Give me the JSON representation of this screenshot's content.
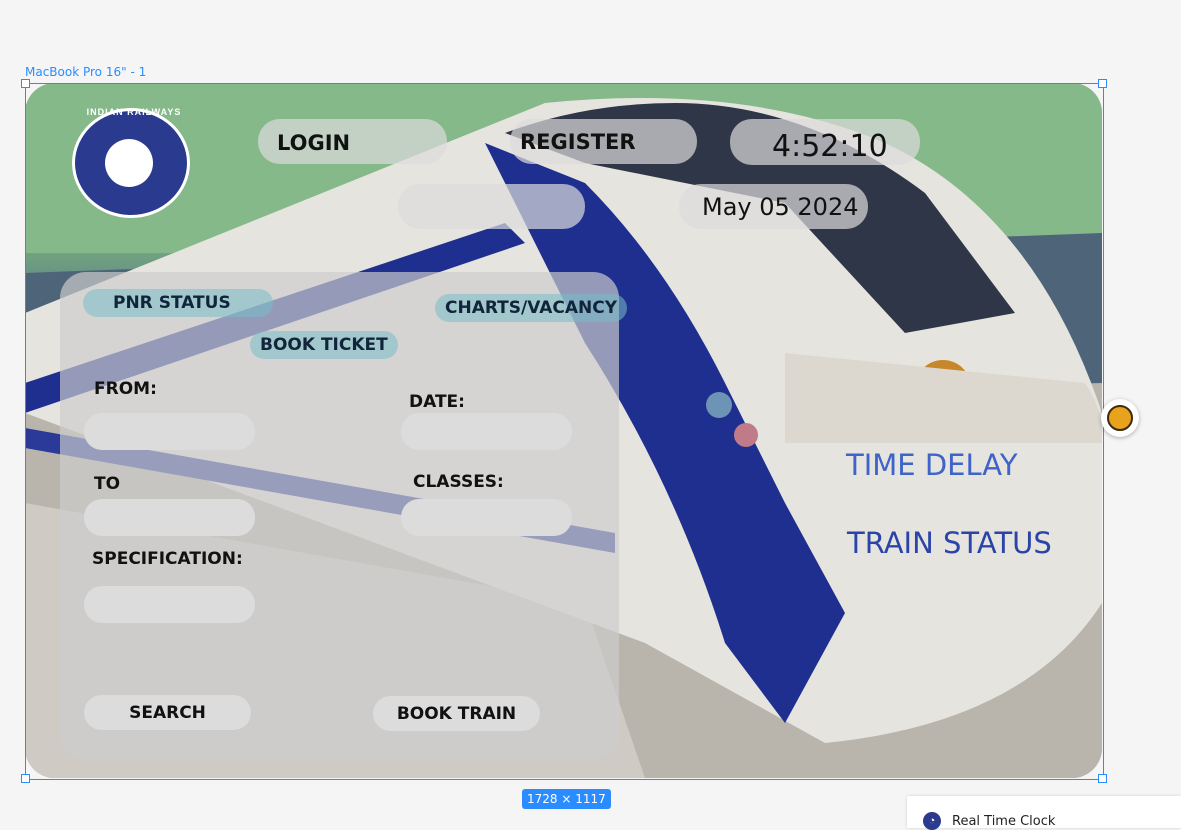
{
  "canvas": {
    "frame_label": "MacBook Pro 16\" - 1",
    "size_badge": "1728 × 1117"
  },
  "header": {
    "login_label": "LOGIN",
    "register_label": "REGISTER",
    "clock": "4:52:10",
    "date": "May 05 2024"
  },
  "logo": {
    "text": "INDIAN RAILWAYS"
  },
  "panel": {
    "tabs": {
      "pnr_status": "PNR STATUS",
      "book_ticket": "BOOK TICKET",
      "charts_vacancy": "CHARTS/VACANCY"
    },
    "labels": {
      "from": "FROM:",
      "date": "DATE:",
      "to": "TO",
      "classes": "CLASSES:",
      "specification": "SPECIFICATION:"
    },
    "buttons": {
      "search": "SEARCH",
      "book_train": "BOOK TRAIN"
    }
  },
  "side_links": {
    "time_delay": "TIME DELAY",
    "train_status": "TRAIN STATUS"
  },
  "plugin": {
    "label": "Real Time Clock"
  },
  "colors": {
    "accent": "#2a8cff",
    "link_time_delay": "#3e63c9",
    "link_train_status": "#2b44a8",
    "logo_blue": "#2a3a8e"
  },
  "icons": {
    "logo": "indian-railways-logo",
    "avatar": "user-avatar-icon",
    "plugin": "clock-icon"
  }
}
